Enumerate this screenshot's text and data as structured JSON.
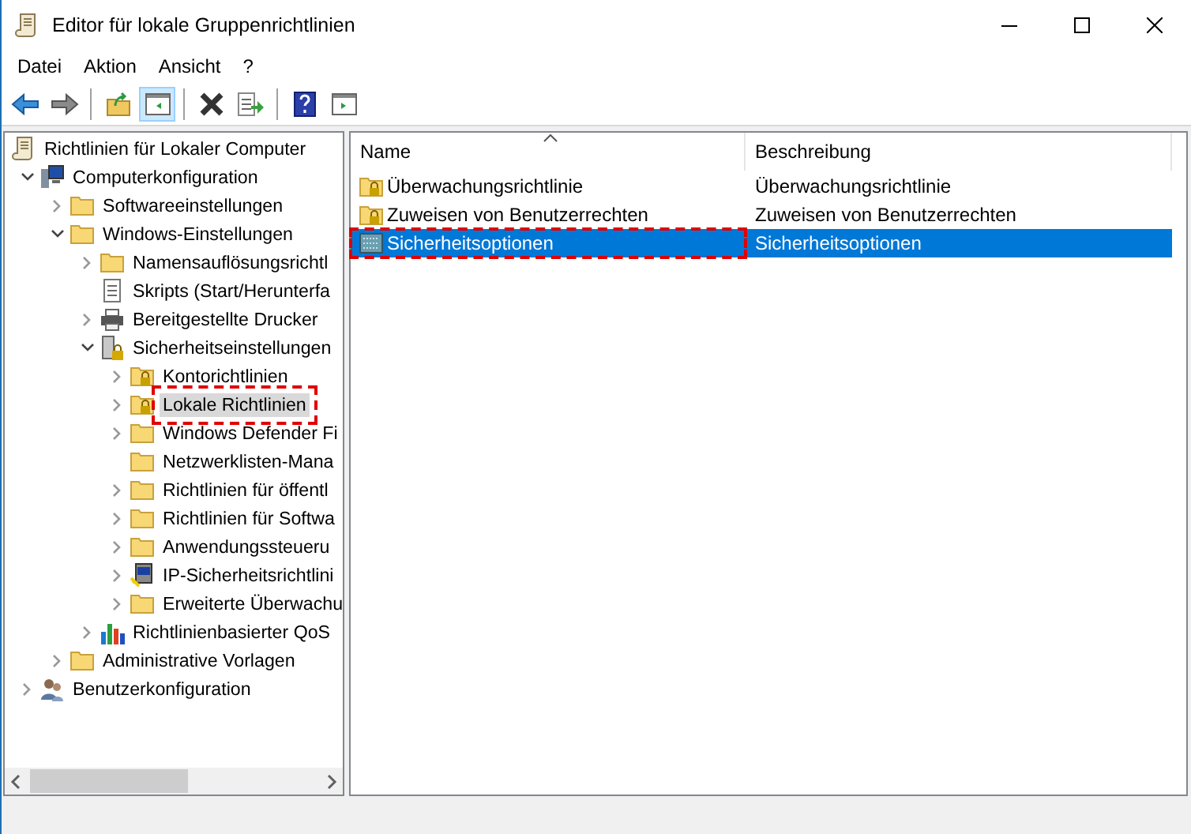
{
  "window": {
    "title": "Editor für lokale Gruppenrichtlinien",
    "controls": [
      {
        "kind": "minimize"
      },
      {
        "kind": "maximize"
      },
      {
        "kind": "close"
      }
    ]
  },
  "menu": [
    "Datei",
    "Aktion",
    "Ansicht",
    "?"
  ],
  "toolbar": [
    {
      "kind": "back",
      "pressed": false
    },
    {
      "kind": "forward",
      "pressed": false
    },
    {
      "kind": "sep"
    },
    {
      "kind": "up",
      "pressed": false
    },
    {
      "kind": "tree",
      "pressed": true
    },
    {
      "kind": "sep"
    },
    {
      "kind": "delete",
      "pressed": false
    },
    {
      "kind": "export",
      "pressed": false
    },
    {
      "kind": "sep"
    },
    {
      "kind": "help",
      "pressed": false
    },
    {
      "kind": "pane",
      "pressed": false
    }
  ],
  "tree": [
    {
      "label": "Richtlinien für Lokaler Computer",
      "kind": "scroll",
      "selected": false,
      "marked": false,
      "children": [
        {
          "label": "Computerkonfiguration",
          "kind": "computer",
          "expanded": true,
          "selected": false,
          "marked": false,
          "children": [
            {
              "label": "Softwareeinstellungen",
              "kind": "folder",
              "expanded": false,
              "selected": false,
              "marked": false
            },
            {
              "label": "Windows-Einstellungen",
              "kind": "folder",
              "expanded": true,
              "selected": false,
              "marked": false,
              "children": [
                {
                  "label": "Namensauflösungsrichtl",
                  "kind": "folder",
                  "expanded": false,
                  "selected": false,
                  "marked": false
                },
                {
                  "label": "Skripts (Start/Herunterfa",
                  "kind": "script",
                  "selected": false,
                  "marked": false
                },
                {
                  "label": "Bereitgestellte Drucker",
                  "kind": "printer",
                  "expanded": false,
                  "selected": false,
                  "marked": false
                },
                {
                  "label": "Sicherheitseinstellungen",
                  "kind": "server",
                  "expanded": true,
                  "selected": false,
                  "marked": false,
                  "children": [
                    {
                      "label": "Kontorichtlinien",
                      "kind": "lockfolder",
                      "expanded": false,
                      "selected": false,
                      "marked": false
                    },
                    {
                      "label": "Lokale Richtlinien",
                      "kind": "lockfolder",
                      "expanded": false,
                      "selected": true,
                      "marked": true
                    },
                    {
                      "label": "Windows Defender Fi",
                      "kind": "folder",
                      "expanded": false,
                      "selected": false,
                      "marked": false
                    },
                    {
                      "label": "Netzwerklisten-Mana",
                      "kind": "folder",
                      "selected": false,
                      "marked": false
                    },
                    {
                      "label": "Richtlinien für öffentl",
                      "kind": "folder",
                      "expanded": false,
                      "selected": false,
                      "marked": false
                    },
                    {
                      "label": "Richtlinien für Softwa",
                      "kind": "folder",
                      "expanded": false,
                      "selected": false,
                      "marked": false
                    },
                    {
                      "label": "Anwendungssteueru",
                      "kind": "folder",
                      "expanded": false,
                      "selected": false,
                      "marked": false
                    },
                    {
                      "label": "IP-Sicherheitsrichtlini",
                      "kind": "ipsec",
                      "expanded": false,
                      "selected": false,
                      "marked": false
                    },
                    {
                      "label": "Erweiterte Überwachu",
                      "kind": "folder",
                      "expanded": false,
                      "selected": false,
                      "marked": false
                    }
                  ]
                },
                {
                  "label": "Richtlinienbasierter QoS",
                  "kind": "qos",
                  "expanded": false,
                  "selected": false,
                  "marked": false
                }
              ]
            },
            {
              "label": "Administrative Vorlagen",
              "kind": "folder",
              "expanded": false,
              "selected": false,
              "marked": false
            }
          ]
        },
        {
          "label": "Benutzerkonfiguration",
          "kind": "user",
          "expanded": false,
          "selected": false,
          "marked": false
        }
      ]
    }
  ],
  "list": {
    "columns": [
      "Name",
      "Beschreibung"
    ],
    "rows": [
      {
        "name": "Überwachungsrichtlinie",
        "description": "Überwachungsrichtlinie",
        "kind": "lockfolder",
        "selected": false,
        "marked": false
      },
      {
        "name": "Zuweisen von Benutzerrechten",
        "description": "Zuweisen von Benutzerrechten",
        "kind": "lockfolder",
        "selected": false,
        "marked": false
      },
      {
        "name": "Sicherheitsoptionen",
        "description": "Sicherheitsoptionen",
        "kind": "options",
        "selected": true,
        "marked": true
      }
    ]
  }
}
